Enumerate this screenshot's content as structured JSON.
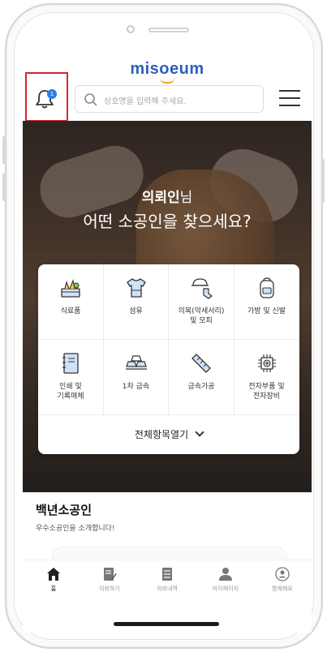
{
  "app": {
    "logo_text": "misoeum"
  },
  "header": {
    "notification_badge": "1",
    "search_placeholder": "상호명을 입력해 주세요."
  },
  "hero": {
    "user_name": "의뢰인",
    "user_suffix": "님",
    "headline": "어떤 소공인을 찾으세요?"
  },
  "categories": [
    {
      "label": "식료품",
      "icon": "food-basket-icon"
    },
    {
      "label": "섬유",
      "icon": "tshirt-icon"
    },
    {
      "label": "의복(악세서리)\n및 모피",
      "icon": "hat-sock-icon"
    },
    {
      "label": "가방 및 신발",
      "icon": "backpack-icon"
    },
    {
      "label": "인쇄 및\n기록매체",
      "icon": "notebook-icon"
    },
    {
      "label": "1차 금속",
      "icon": "gold-bars-icon"
    },
    {
      "label": "금속가공",
      "icon": "wrench-icon"
    },
    {
      "label": "전자부품 및\n전자장비",
      "icon": "chip-icon"
    }
  ],
  "expand_label": "전체항목열기",
  "section": {
    "title": "백년소공인",
    "subtitle": "우수소공인을 소개합니다!"
  },
  "tabs": [
    {
      "label": "홈",
      "icon": "home-icon",
      "active": true
    },
    {
      "label": "의뢰하기",
      "icon": "edit-document-icon",
      "active": false
    },
    {
      "label": "의뢰내역",
      "icon": "list-document-icon",
      "active": false
    },
    {
      "label": "마이페이지",
      "icon": "person-icon",
      "active": false
    },
    {
      "label": "함께해요",
      "icon": "search-person-icon",
      "active": false
    }
  ],
  "colors": {
    "brand_blue": "#2c5fbf",
    "brand_accent": "#f1a21c",
    "highlight_border": "#d9262c",
    "badge": "#2d7de6"
  }
}
